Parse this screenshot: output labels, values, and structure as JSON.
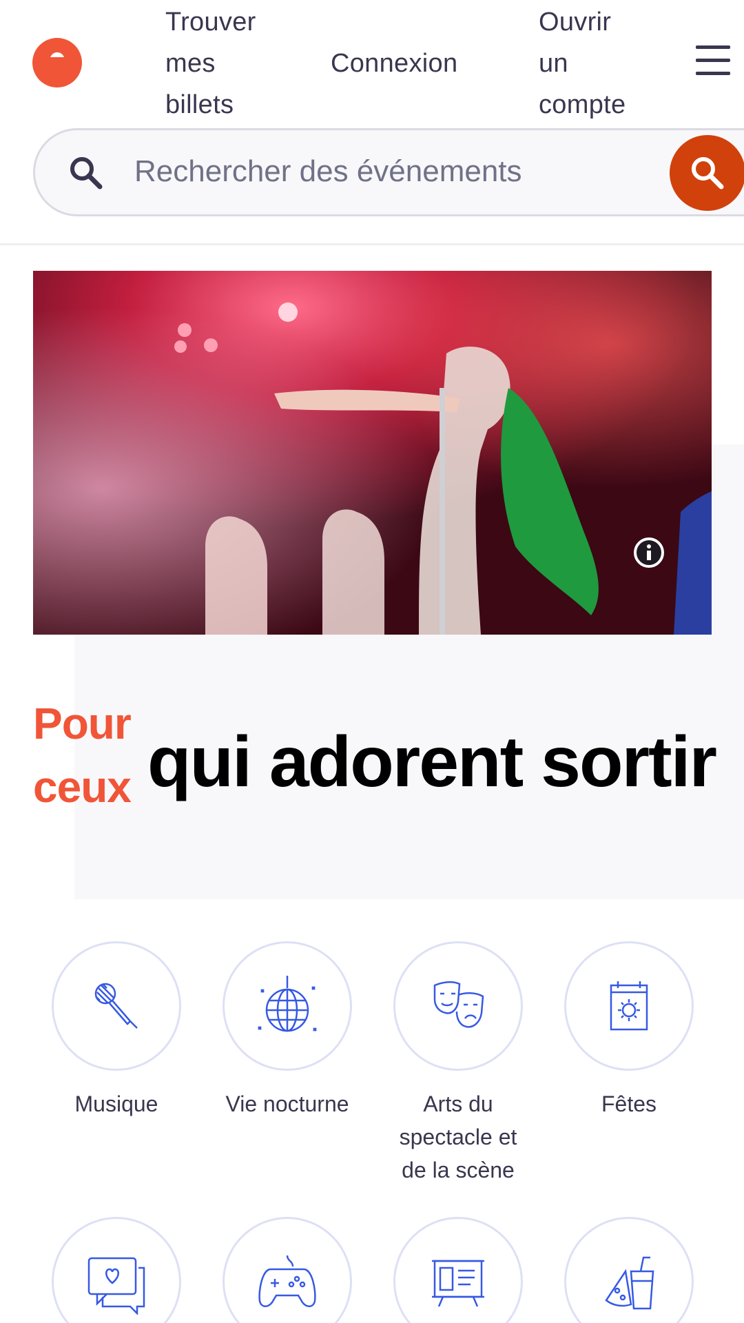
{
  "header": {
    "nav_tickets": "Trouver\nmes\nbillets",
    "nav_login": "Connexion",
    "nav_signup": "Ouvrir\nun\ncompte"
  },
  "search": {
    "placeholder": "Rechercher des événements"
  },
  "hero": {
    "tagline_small": "Pour\nceux",
    "tagline_big": "qui adorent sortir"
  },
  "categories": [
    {
      "label": "Musique",
      "icon": "microphone-icon"
    },
    {
      "label": "Vie nocturne",
      "icon": "disco-ball-icon"
    },
    {
      "label": "Arts du\nspectacle et\nde la scène",
      "icon": "theater-masks-icon"
    },
    {
      "label": "Fêtes",
      "icon": "calendar-sun-icon"
    },
    {
      "label": "",
      "icon": "chat-heart-icon"
    },
    {
      "label": "",
      "icon": "game-controller-icon"
    },
    {
      "label": "",
      "icon": "presentation-board-icon"
    },
    {
      "label": "",
      "icon": "food-drink-icon"
    }
  ],
  "colors": {
    "brand": "#f05537",
    "search_button": "#d1410c",
    "icon_blue": "#3659e3",
    "text": "#39364f"
  }
}
